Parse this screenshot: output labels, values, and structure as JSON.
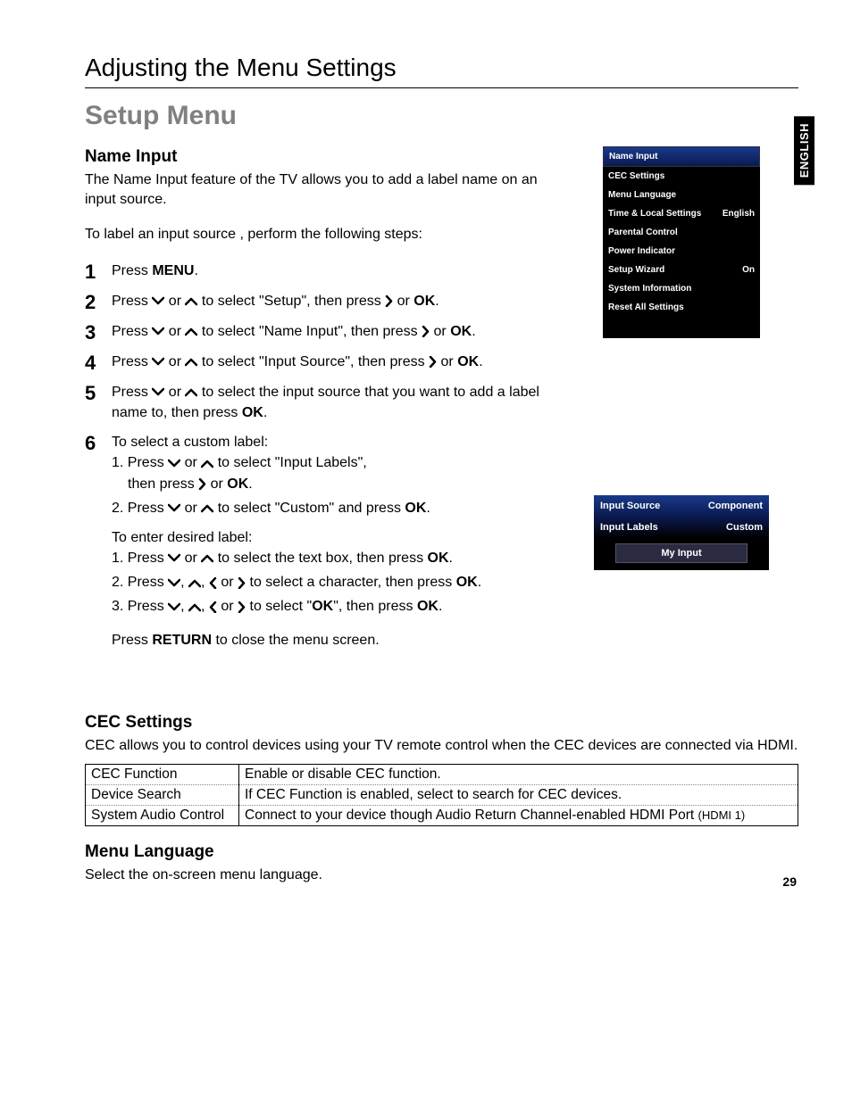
{
  "lang_tab": "ENGLISH",
  "section_header": "Adjusting the Menu Settings",
  "title": "Setup Menu",
  "name_input": {
    "heading": "Name Input",
    "intro": "The Name Input feature of the TV allows you to add a label name on an input source.",
    "lead": "To label an input source , perform the following steps:",
    "step1_a": "Press ",
    "step1_b": "MENU",
    "step1_c": ".",
    "step2_a": "Press ",
    "step2_b": " or ",
    "step2_c": " to select \"Setup\", then press ",
    "step2_d": " or ",
    "step2_ok": "OK",
    "step2_e": ".",
    "step3_a": "Press ",
    "step3_b": " or ",
    "step3_c": " to select \"Name Input\", then press ",
    "step3_d": " or ",
    "step3_ok": "OK",
    "step3_e": ".",
    "step4_a": "Press ",
    "step4_b": " or ",
    "step4_c": "  to select \"Input Source\", then press ",
    "step4_d": " or ",
    "step4_ok": "OK",
    "step4_e": ".",
    "step5_a": " Press ",
    "step5_b": " or ",
    "step5_c": " to select the input source that you want to add a label name to, then press ",
    "step5_ok": "OK",
    "step5_d": ".",
    "step6_lead": "To select a custom label:",
    "step6_1a": "1. Press ",
    "step6_1b": " or ",
    "step6_1c": "  to select \"Input Labels\",",
    "step6_1d": "then press ",
    "step6_1e": " or ",
    "step6_1ok": "OK",
    "step6_1f": ".",
    "step6_2a": "2. Press ",
    "step6_2b": " or ",
    "step6_2c": "  to select \"Custom\" and press ",
    "step6_2ok": "OK",
    "step6_2d": ".",
    "enter_lead": "To enter desired label:",
    "enter_1a": "1. Press ",
    "enter_1b": " or ",
    "enter_1c": "  to select the text box, then press ",
    "enter_1ok": "OK",
    "enter_1d": ".",
    "enter_2a": "2. Press ",
    "enter_2sep": ",  ",
    "enter_2b": ", ",
    "enter_2c": " or ",
    "enter_2d": " to select a character, then press ",
    "enter_2ok": "OK",
    "enter_2e": ".",
    "enter_3a": "3. Press ",
    "enter_3sep": ",  ",
    "enter_3b": ", ",
    "enter_3c": " or ",
    "enter_3d": " to select \"",
    "enter_3ok1": "OK",
    "enter_3e": "\", then press ",
    "enter_3ok2": "OK",
    "enter_3f": ".",
    "return_a": "Press ",
    "return_b": "RETURN",
    "return_c": " to close the menu screen."
  },
  "menu1": {
    "hl": "Name Input",
    "r1": "CEC Settings",
    "r2": "Menu Language",
    "r3l": "Time & Local Settings",
    "r3r": "English",
    "r4": "Parental Control",
    "r5": "Power Indicator",
    "r6l": "Setup Wizard",
    "r6r": "On",
    "r7": "System Information",
    "r8": "Reset All Settings"
  },
  "menu2": {
    "r1l": "Input Source",
    "r1r": "Component",
    "r2l": "Input Labels",
    "r2r": "Custom",
    "box": "My Input"
  },
  "cec": {
    "heading": "CEC Settings",
    "intro": "CEC allows you to control devices using your TV remote control when the CEC devices are connected via HDMI.",
    "r1a": "CEC Function",
    "r1b": "Enable or disable CEC function.",
    "r2a": "Device Search",
    "r2b": "If CEC Function is enabled, select to search for CEC devices.",
    "r3a": "System Audio Control",
    "r3b_a": "Connect to your device though Audio Return Channel-enabled HDMI Port ",
    "r3b_b": "(HDMI 1)"
  },
  "menu_lang": {
    "heading": "Menu Language",
    "body": "Select the on-screen menu language."
  },
  "page_num": "29",
  "nums": {
    "n1": "1",
    "n2": "2",
    "n3": "3",
    "n4": "4",
    "n5": "5",
    "n6": "6"
  }
}
